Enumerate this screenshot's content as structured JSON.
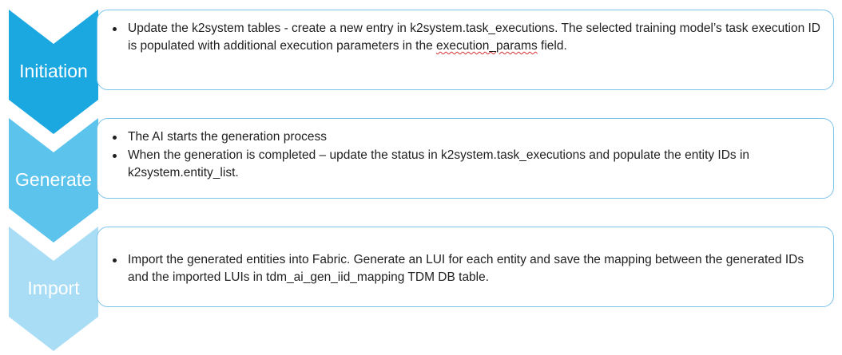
{
  "colors": {
    "initiation": "#1ba8e0",
    "generate": "#5bc3ec",
    "import": "#a9ddf6",
    "card_border": "#7cc3ea"
  },
  "steps": [
    {
      "label": "Initiation",
      "bullets": [
        {
          "pre": "Update the k2system tables - create a new entry in k2system.task_executions. The selected training model’s task execution ID is populated with additional execution parameters in the ",
          "flagged": "execution_params",
          "post": " field."
        }
      ]
    },
    {
      "label": "Generate",
      "bullets": [
        {
          "text": "The AI starts the generation process"
        },
        {
          "text": "When the generation is completed – update the status in k2system.task_executions and populate the entity IDs in k2system.entity_list."
        }
      ]
    },
    {
      "label": "Import",
      "bullets": [
        {
          "text": "Import the generated entities into Fabric. Generate an LUI for each entity and save the mapping between the generated IDs and the imported LUIs in tdm_ai_gen_iid_mapping TDM DB table."
        }
      ]
    }
  ]
}
